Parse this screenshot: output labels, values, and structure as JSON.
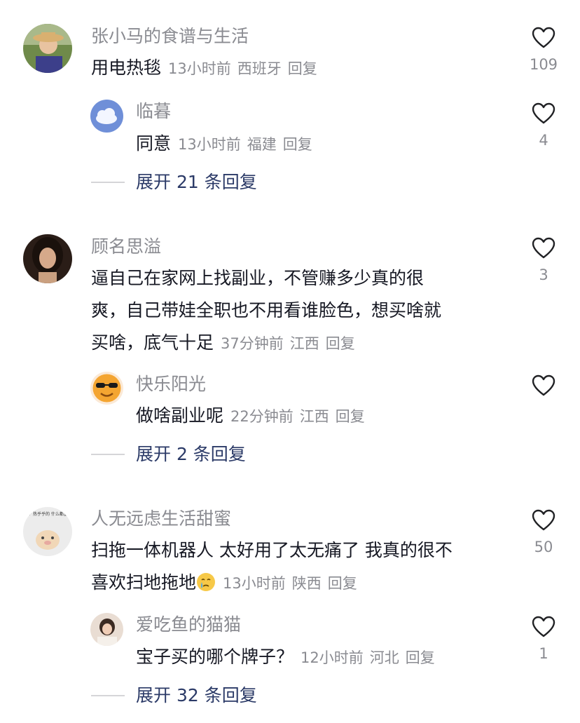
{
  "comments": [
    {
      "name": "张小马的食谱与生活",
      "text": "用电热毯",
      "time": "13小时前",
      "location": "西班牙",
      "reply": "回复",
      "likes": "109",
      "replies": [
        {
          "name": "临暮",
          "text": "同意",
          "time": "13小时前",
          "location": "福建",
          "reply": "回复",
          "likes": "4"
        }
      ],
      "expand_label": "展开 21 条回复"
    },
    {
      "name": "顾名思溢",
      "text_lines": [
        "逼自己在家网上找副业，不管赚多少真的很",
        "爽，自己带娃全职也不用看谁脸色，想买啥就",
        "买啥，底气十足"
      ],
      "time": "37分钟前",
      "location": "江西",
      "reply": "回复",
      "likes": "3",
      "replies": [
        {
          "name": "快乐阳光",
          "text": "做啥副业呢",
          "time": "22分钟前",
          "location": "江西",
          "reply": "回复",
          "likes": ""
        }
      ],
      "expand_label": "展开 2 条回复"
    },
    {
      "name": "人无远虑生活甜蜜",
      "text_lines": [
        "扫拖一体机器人 太好用了太无痛了 我真的很不",
        "喜欢扫地拖地"
      ],
      "emoji": "crying-face-emoji",
      "time": "13小时前",
      "location": "陕西",
      "reply": "回复",
      "likes": "50",
      "avatar_text": "一个 热乎乎的 什么都重要",
      "replies": [
        {
          "name": "爱吃鱼的猫猫",
          "text": "宝子买的哪个牌子？",
          "time": "12小时前",
          "location": "河北",
          "reply": "回复",
          "likes": "1"
        }
      ],
      "expand_label": "展开 32 条回复"
    }
  ],
  "icons": {
    "like": "heart-outline-icon"
  },
  "colors": {
    "name": "#8a8b91",
    "text": "#161823",
    "expand": "#2b3a67"
  }
}
